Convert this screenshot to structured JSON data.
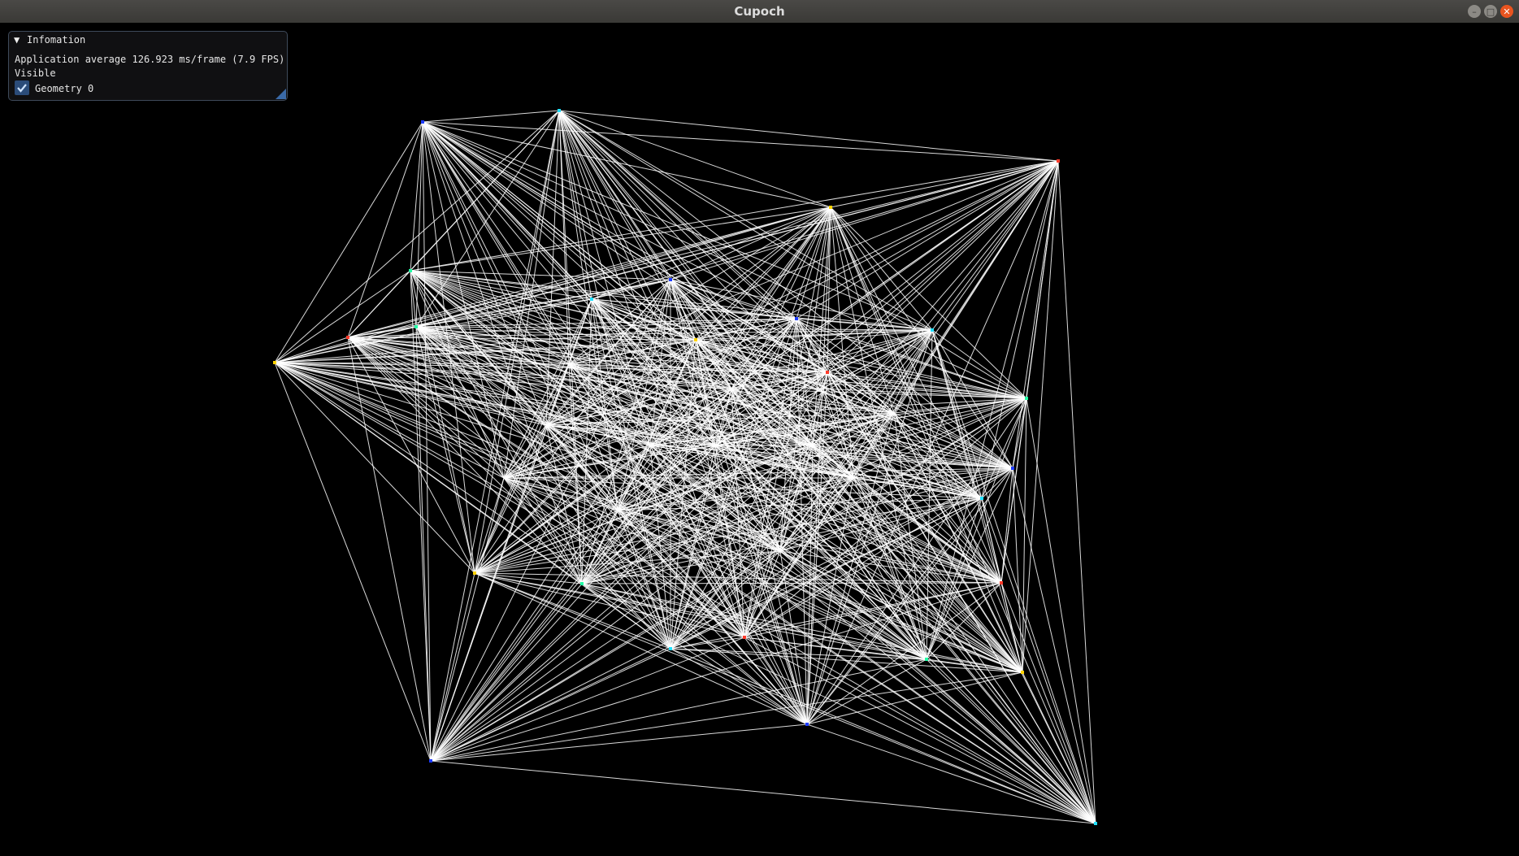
{
  "window": {
    "title": "Cupoch",
    "background_color": "#000000",
    "controls": [
      "minimize-icon",
      "maximize-icon",
      "close-icon"
    ]
  },
  "info_panel": {
    "title": "Infomation",
    "collapse_icon": "triangle-down-icon",
    "stats_text": "Application average 126.923 ms/frame (7.9 FPS)",
    "visible_label": "Visible",
    "geometry_label": "Geometry 0",
    "geometry_checked": true,
    "accent_color": "#2b4c79"
  },
  "scene": {
    "description_type": "graph-wireframe",
    "line_color": "#ffffff"
  }
}
